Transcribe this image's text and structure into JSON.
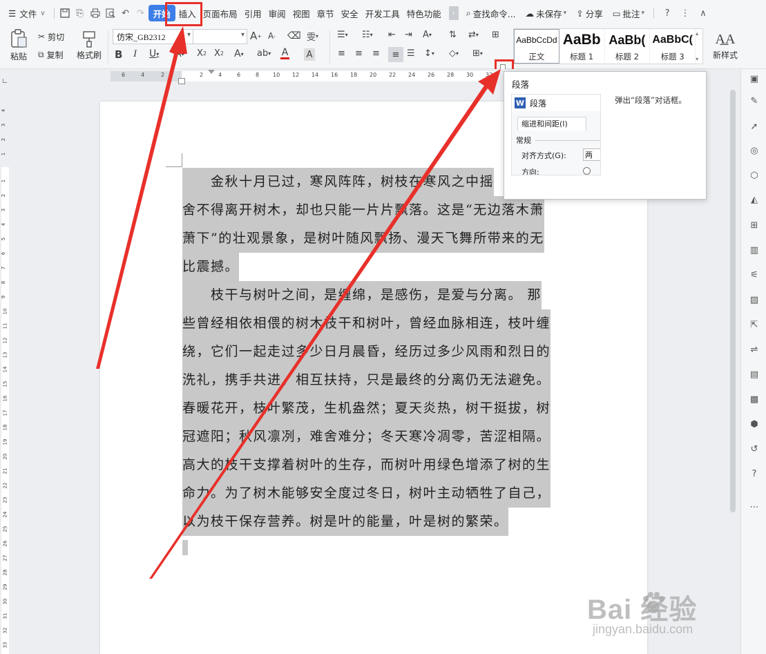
{
  "menubar": {
    "file_label": "文件",
    "tabs": [
      "开始",
      "插入",
      "页面布局",
      "引用",
      "审阅",
      "视图",
      "章节",
      "安全",
      "开发工具",
      "特色功能"
    ],
    "active_tab": "开始",
    "search_label": "查找命令...",
    "unsaved_label": "未保存",
    "share_label": "分享",
    "comment_label": "批注"
  },
  "ribbon": {
    "paste_label": "粘贴",
    "cut_label": "剪切",
    "copy_label": "复制",
    "format_painter_label": "格式刷",
    "font_name": "仿宋_GB2312",
    "font_size": "",
    "styles": [
      {
        "sample": "AaBbCcDd",
        "name": "正文"
      },
      {
        "sample": "AaBb",
        "name": "标题 1"
      },
      {
        "sample": "AaBb(",
        "name": "标题 2"
      },
      {
        "sample": "AaBbC(",
        "name": "标题 3"
      }
    ],
    "new_style_label": "新样式"
  },
  "ruler": {
    "h_numbers": [
      "6",
      "4",
      "2",
      "2",
      "4",
      "6",
      "8",
      "10",
      "12",
      "14",
      "16",
      "18",
      "20",
      "22",
      "24",
      "26",
      "28",
      "30",
      "32"
    ],
    "v_numbers": [
      "4",
      "3",
      "2",
      "1",
      "1",
      "2",
      "3",
      "4",
      "5",
      "6",
      "7",
      "8",
      "9",
      "10",
      "11",
      "12",
      "13",
      "14",
      "15",
      "16",
      "17",
      "18",
      "19",
      "20",
      "21",
      "22",
      "23",
      "24",
      "25",
      "26",
      "27",
      "28",
      "29",
      "30",
      "31",
      "32",
      "33"
    ]
  },
  "document": {
    "lines": [
      "　　金秋十月已过，寒风阵阵，树枝在寒风之中摇",
      "舍不得离开树木，却也只能一片片飘落。这是“无边落木萧",
      "萧下”的壮观景象，是树叶随风飘扬、漫天飞舞所带来的无",
      "比震撼。",
      "　　枝干与树叶之间，是缠绵，是感伤，是爱与分离。 那",
      "些曾经相依相偎的树木枝干和树叶，曾经血脉相连，枝叶缠",
      "绕，它们一起走过多少日月晨昏，经历过多少风雨和烈日的",
      "洗礼，携手共进，相互扶持，只是最终的分离仍无法避免。",
      "春暖花开，枝叶繁茂，生机盎然；夏天炎热，树干挺拔，树",
      "冠遮阳；秋风凛冽，难舍难分；冬天寒冷凋零，苦涩相隔。",
      "高大的枝干支撑着树叶的生存，而树叶用绿色增添了树的生",
      "命力。为了树木能够安全度过冬日，树叶主动牺牲了自己，",
      "以为枝干保存营养。树是叶的能量，叶是树的繁荣。"
    ]
  },
  "popup": {
    "title": "段落",
    "description": "弹出“段落”对话框。",
    "dialog_title": "段落",
    "dialog_logo": "W",
    "dialog_tab": "缩进和间距(I)",
    "section": "常规",
    "align_label": "对齐方式(G):",
    "align_value": "两",
    "direction_label": "方向:"
  },
  "watermark": {
    "brand": "Bai  经验",
    "url": "jingyan.baidu.com"
  },
  "colors": {
    "accent": "#3d7ee8",
    "annotation_red": "#e8302a",
    "selection_gray": "#c8c8c8"
  }
}
